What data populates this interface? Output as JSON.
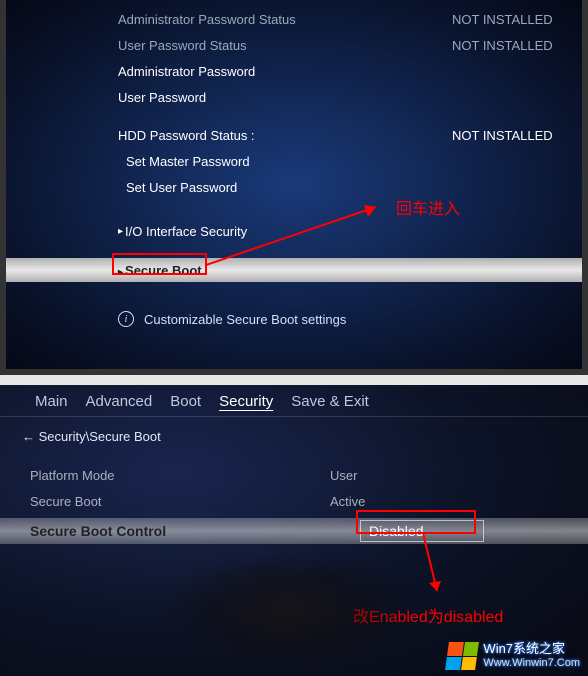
{
  "panel1": {
    "rows": [
      {
        "label": "Administrator Password Status",
        "value": "NOT INSTALLED",
        "dim": true
      },
      {
        "label": "User Password Status",
        "value": "NOT INSTALLED",
        "dim": true
      },
      {
        "label": "Administrator Password",
        "value": ""
      },
      {
        "label": "User Password",
        "value": ""
      }
    ],
    "hdd_row": {
      "label": "HDD Password Status :",
      "value": "NOT INSTALLED"
    },
    "set_master": "Set Master Password",
    "set_user": "Set User Password",
    "io_security": "I/O Interface Security",
    "secure_boot": "Secure Boot",
    "info_text": "Customizable Secure Boot settings",
    "annotation": "回车进入"
  },
  "panel2": {
    "tabs": [
      "Main",
      "Advanced",
      "Boot",
      "Security",
      "Save & Exit"
    ],
    "active_tab": 3,
    "breadcrumb": "Security\\Secure Boot",
    "settings": [
      {
        "label": "Platform Mode",
        "value": "User"
      },
      {
        "label": "Secure Boot",
        "value": "Active"
      }
    ],
    "highlighted": {
      "label": "Secure Boot Control",
      "value": "Disabled"
    },
    "annotation": "改Enabled为disabled"
  },
  "watermark": {
    "line1": "Win7系统之家",
    "line2": "Www.Winwin7.Com"
  }
}
